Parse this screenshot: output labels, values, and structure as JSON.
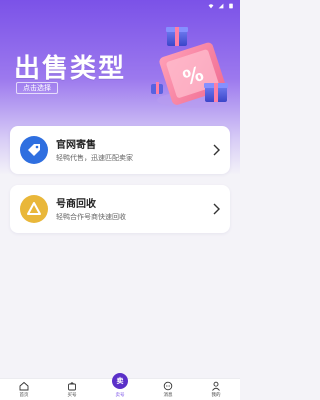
{
  "hero": {
    "title": "出售类型",
    "subtitle": "点击选择"
  },
  "options": [
    {
      "title": "官网寄售",
      "desc": "轻鸭代售，迅速匹配卖家",
      "icon": "price-tag-icon"
    },
    {
      "title": "号商回收",
      "desc": "轻鸭合作号商快速回收",
      "icon": "recycle-icon"
    }
  ],
  "tabbar": {
    "items": [
      {
        "label": "首页",
        "icon": "home-icon"
      },
      {
        "label": "买号",
        "icon": "shopping-bag-icon"
      },
      {
        "label": "卖号",
        "icon": "sell-icon",
        "badge": "卖",
        "active": true
      },
      {
        "label": "消息",
        "icon": "chat-icon"
      },
      {
        "label": "我的",
        "icon": "user-icon"
      }
    ]
  },
  "colors": {
    "accent": "#7b52e8",
    "accent_dark": "#5a2fc8",
    "consign_icon_bg": "#2f6fe0",
    "recycle_icon_bg": "#e9b73a"
  }
}
